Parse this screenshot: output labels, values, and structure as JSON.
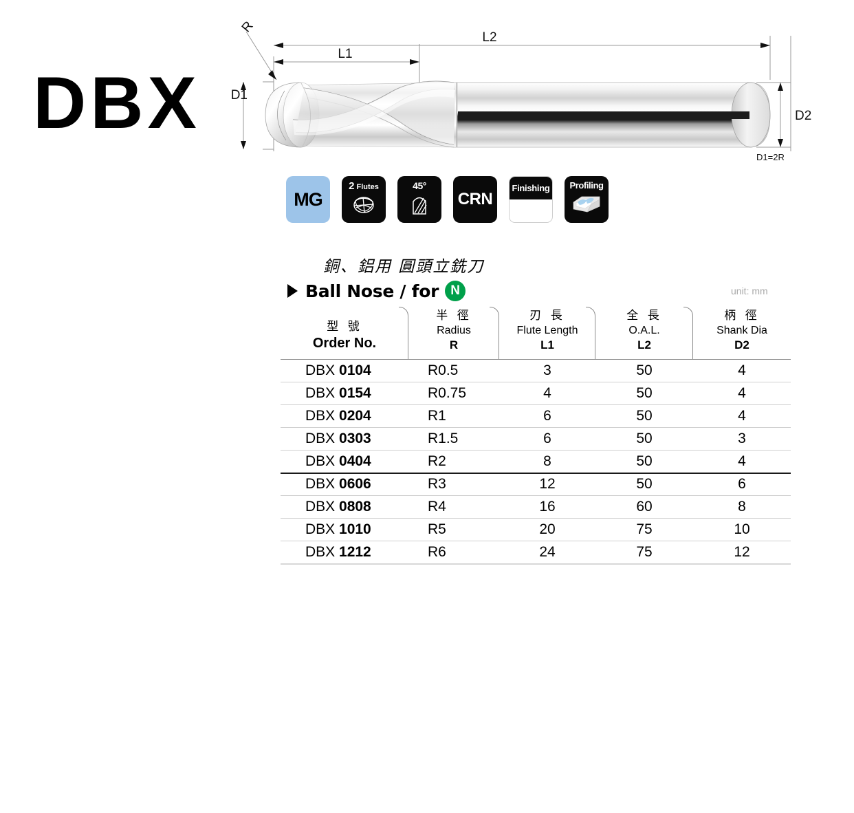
{
  "series": {
    "code": "DBX"
  },
  "drawing": {
    "labels": {
      "radius": "R",
      "flute_length": "L1",
      "overall_length": "L2",
      "cut_dia": "D1",
      "shank_dia": "D2",
      "note": "D1=2R"
    }
  },
  "badges": [
    {
      "name": "material-grade",
      "type": "mg",
      "text": "MG"
    },
    {
      "name": "flute-count",
      "type": "flutes",
      "count": "2",
      "label": "Flutes"
    },
    {
      "name": "helix-angle",
      "type": "angle",
      "text": "45°"
    },
    {
      "name": "coating",
      "type": "crn",
      "text": "CRN"
    },
    {
      "name": "finishing",
      "type": "finishing",
      "text": "Finishing"
    },
    {
      "name": "profiling",
      "type": "profiling",
      "text": "Profiling"
    }
  ],
  "description": {
    "cn": "銅、鋁用 圓頭立銑刀",
    "en": "Ball Nose / for",
    "material_code": "N"
  },
  "unit_note": "unit: mm",
  "table": {
    "headers": [
      {
        "cn": "型 號",
        "en": "Order No.",
        "sym": "",
        "en_bold": true
      },
      {
        "cn": "半 徑",
        "en": "Radius",
        "sym": "R",
        "en_bold": false
      },
      {
        "cn": "刃 長",
        "en": "Flute Length",
        "sym": "L1",
        "en_bold": false
      },
      {
        "cn": "全 長",
        "en": "O.A.L.",
        "sym": "L2",
        "en_bold": false
      },
      {
        "cn": "柄 徑",
        "en": "Shank Dia",
        "sym": "D2",
        "en_bold": false
      }
    ],
    "rows": [
      {
        "prefix": "DBX",
        "number": "0104",
        "radius": "R0.5",
        "l1": "3",
        "l2": "50",
        "d2": "4",
        "thick_after": false
      },
      {
        "prefix": "DBX",
        "number": "0154",
        "radius": "R0.75",
        "l1": "4",
        "l2": "50",
        "d2": "4",
        "thick_after": false
      },
      {
        "prefix": "DBX",
        "number": "0204",
        "radius": "R1",
        "l1": "6",
        "l2": "50",
        "d2": "4",
        "thick_after": false
      },
      {
        "prefix": "DBX",
        "number": "0303",
        "radius": "R1.5",
        "l1": "6",
        "l2": "50",
        "d2": "3",
        "thick_after": false
      },
      {
        "prefix": "DBX",
        "number": "0404",
        "radius": "R2",
        "l1": "8",
        "l2": "50",
        "d2": "4",
        "thick_after": true
      },
      {
        "prefix": "DBX",
        "number": "0606",
        "radius": "R3",
        "l1": "12",
        "l2": "50",
        "d2": "6",
        "thick_after": false
      },
      {
        "prefix": "DBX",
        "number": "0808",
        "radius": "R4",
        "l1": "16",
        "l2": "60",
        "d2": "8",
        "thick_after": false
      },
      {
        "prefix": "DBX",
        "number": "1010",
        "radius": "R5",
        "l1": "20",
        "l2": "75",
        "d2": "10",
        "thick_after": false
      },
      {
        "prefix": "DBX",
        "number": "1212",
        "radius": "R6",
        "l1": "24",
        "l2": "75",
        "d2": "12",
        "thick_after": false
      }
    ]
  },
  "colors": {
    "mg_badge_bg": "#9dc4e9",
    "badge_bg": "#0a0a0a",
    "material_badge_bg": "#00a04a",
    "unit_note": "#a8a8a8",
    "rule": "#cfcfcf"
  }
}
